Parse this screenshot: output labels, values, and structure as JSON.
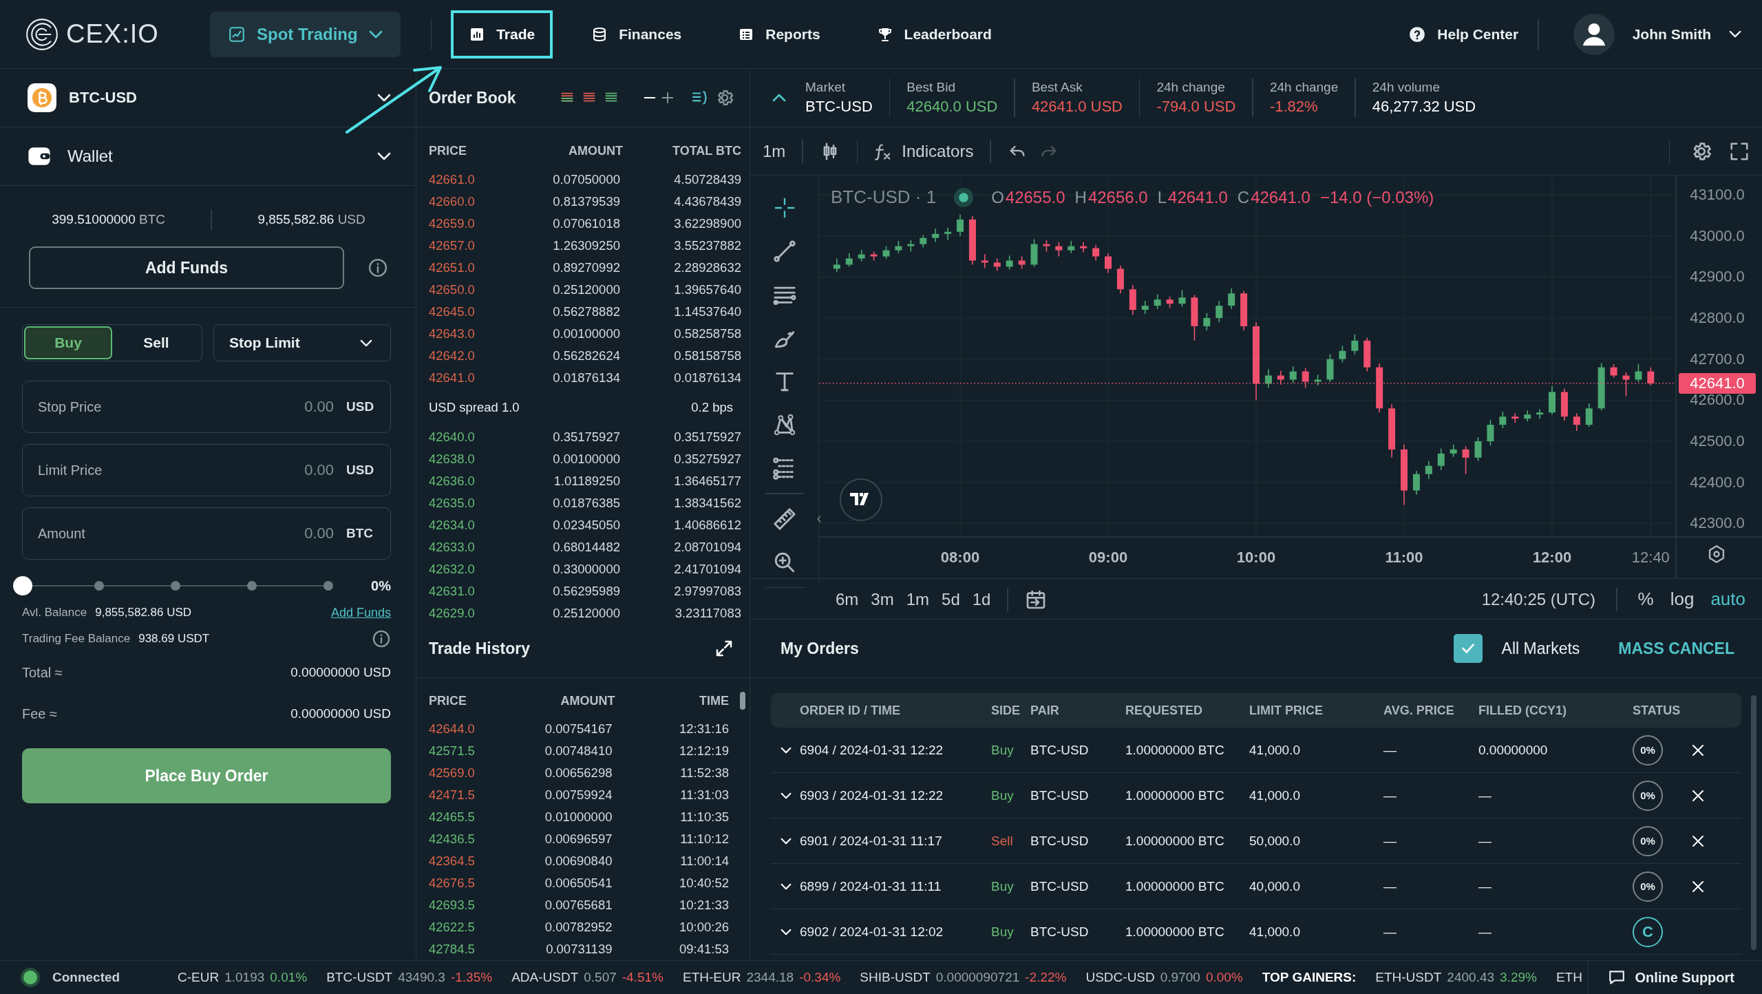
{
  "header": {
    "logo": "CEX:IO",
    "product": "Spot Trading",
    "nav": [
      {
        "label": "Trade",
        "selected": true
      },
      {
        "label": "Finances",
        "selected": false
      },
      {
        "label": "Reports",
        "selected": false
      },
      {
        "label": "Leaderboard",
        "selected": false
      }
    ],
    "help": "Help Center",
    "user": "John Smith"
  },
  "pair": {
    "name": "BTC-USD"
  },
  "wallet": {
    "title": "Wallet",
    "balances": [
      {
        "amount": "399.51000000",
        "currency": "BTC"
      },
      {
        "amount": "9,855,582.86",
        "currency": "USD"
      }
    ],
    "add_funds": "Add Funds"
  },
  "order_form": {
    "sides": [
      {
        "label": "Buy",
        "selected": true
      },
      {
        "label": "Sell",
        "selected": false
      }
    ],
    "order_type": "Stop Limit",
    "fields": [
      {
        "label": "Stop Price",
        "placeholder": "0.00",
        "unit": "USD"
      },
      {
        "label": "Limit Price",
        "placeholder": "0.00",
        "unit": "USD"
      },
      {
        "label": "Amount",
        "placeholder": "0.00",
        "unit": "BTC"
      }
    ],
    "slider": {
      "level": 0,
      "reading": "0%"
    },
    "avl_balance": {
      "label": "Avl. Balance",
      "value": "9,855,582.86 USD",
      "link": "Add Funds"
    },
    "fee_balance": {
      "label": "Trading Fee Balance",
      "value": "938.69 USDT"
    },
    "total": {
      "label": "Total ≈",
      "value": "0.00000000 USD"
    },
    "fee": {
      "label": "Fee ≈",
      "value": "0.00000000 USD"
    },
    "submit": "Place Buy Order"
  },
  "order_book": {
    "title": "Order Book",
    "columns": [
      "PRICE",
      "AMOUNT",
      "TOTAL BTC"
    ],
    "asks": [
      {
        "price": "42661.0",
        "amount": "0.07050000",
        "total": "4.50728439"
      },
      {
        "price": "42660.0",
        "amount": "0.81379539",
        "total": "4.43678439"
      },
      {
        "price": "42659.0",
        "amount": "0.07061018",
        "total": "3.62298900"
      },
      {
        "price": "42657.0",
        "amount": "1.26309250",
        "total": "3.55237882"
      },
      {
        "price": "42651.0",
        "amount": "0.89270992",
        "total": "2.28928632"
      },
      {
        "price": "42650.0",
        "amount": "0.25120000",
        "total": "1.39657640"
      },
      {
        "price": "42645.0",
        "amount": "0.56278882",
        "total": "1.14537640"
      },
      {
        "price": "42643.0",
        "amount": "0.00100000",
        "total": "0.58258758"
      },
      {
        "price": "42642.0",
        "amount": "0.56282624",
        "total": "0.58158758"
      },
      {
        "price": "42641.0",
        "amount": "0.01876134",
        "total": "0.01876134"
      }
    ],
    "spread": {
      "label": "USD spread",
      "value": "1.0",
      "bps": "0.2 bps"
    },
    "bids": [
      {
        "price": "42640.0",
        "amount": "0.35175927",
        "total": "0.35175927"
      },
      {
        "price": "42638.0",
        "amount": "0.00100000",
        "total": "0.35275927"
      },
      {
        "price": "42636.0",
        "amount": "1.01189250",
        "total": "1.36465177"
      },
      {
        "price": "42635.0",
        "amount": "0.01876385",
        "total": "1.38341562"
      },
      {
        "price": "42634.0",
        "amount": "0.02345050",
        "total": "1.40686612"
      },
      {
        "price": "42633.0",
        "amount": "0.68014482",
        "total": "2.08701094"
      },
      {
        "price": "42632.0",
        "amount": "0.33000000",
        "total": "2.41701094"
      },
      {
        "price": "42631.0",
        "amount": "0.56295989",
        "total": "2.97997083"
      },
      {
        "price": "42629.0",
        "amount": "0.25120000",
        "total": "3.23117083"
      }
    ]
  },
  "trade_history": {
    "title": "Trade History",
    "columns": [
      "PRICE",
      "AMOUNT",
      "TIME"
    ],
    "rows": [
      {
        "price": "42644.0",
        "amount": "0.00754167",
        "time": "12:31:16",
        "color": "#dc6449"
      },
      {
        "price": "42571.5",
        "amount": "0.00748410",
        "time": "12:12:19",
        "color": "#66bb74"
      },
      {
        "price": "42569.0",
        "amount": "0.00656298",
        "time": "11:52:38",
        "color": "#dc6449"
      },
      {
        "price": "42471.5",
        "amount": "0.00759924",
        "time": "11:31:03",
        "color": "#dc6449"
      },
      {
        "price": "42465.5",
        "amount": "0.01000000",
        "time": "11:10:35",
        "color": "#66bb74"
      },
      {
        "price": "42436.5",
        "amount": "0.00696597",
        "time": "11:10:12",
        "color": "#66bb74"
      },
      {
        "price": "42364.5",
        "amount": "0.00690840",
        "time": "11:00:14",
        "color": "#dc6449"
      },
      {
        "price": "42676.5",
        "amount": "0.00650541",
        "time": "10:40:52",
        "color": "#dc6449"
      },
      {
        "price": "42693.5",
        "amount": "0.00765681",
        "time": "10:21:33",
        "color": "#66bb74"
      },
      {
        "price": "42622.5",
        "amount": "0.00782952",
        "time": "10:00:26",
        "color": "#66bb74"
      },
      {
        "price": "42784.5",
        "amount": "0.00731139",
        "time": "09:41:53",
        "color": "#66bb74"
      }
    ]
  },
  "market_stats": [
    {
      "label": "Market",
      "value": "BTC-USD",
      "color": "#ffffff"
    },
    {
      "label": "Best Bid",
      "value": "42640.0 USD",
      "color": "#66bb74"
    },
    {
      "label": "Best Ask",
      "value": "42641.0 USD",
      "color": "#ee5a55"
    },
    {
      "label": "24h change",
      "value": "-794.0 USD",
      "color": "#ee5a55"
    },
    {
      "label": "24h change",
      "value": "-1.82%",
      "color": "#ee5a55"
    },
    {
      "label": "24h volume",
      "value": "46,277.32 USD",
      "color": "#ffffff"
    }
  ],
  "chart": {
    "interval": "1m",
    "indicators": "Indicators",
    "symbol": "BTC-USD · 1",
    "ohlc": [
      {
        "key": "O",
        "value": "42655.0"
      },
      {
        "key": "H",
        "value": "42656.0"
      },
      {
        "key": "L",
        "value": "42641.0"
      },
      {
        "key": "C",
        "value": "42641.0"
      }
    ],
    "change": "−14.0 (−0.03%)",
    "chart_data": {
      "type": "candlestick",
      "grid": true,
      "ref_lines": [
        {
          "axis": "y",
          "value": 42641,
          "label": "42641.0"
        }
      ],
      "categories": [
        null,
        null,
        null,
        null,
        null,
        null,
        null,
        null,
        null,
        null,
        "08:00",
        null,
        null,
        null,
        null,
        null,
        null,
        null,
        null,
        null,
        null,
        null,
        "09:00",
        null,
        null,
        null,
        null,
        null,
        null,
        null,
        null,
        null,
        null,
        null,
        "10:00",
        null,
        null,
        null,
        null,
        null,
        null,
        null,
        null,
        null,
        null,
        null,
        "11:00",
        null,
        null,
        null,
        null,
        null,
        null,
        null,
        null,
        null,
        null,
        null,
        "12:00",
        null,
        null,
        null,
        null,
        null,
        null,
        null,
        "12:40"
      ],
      "ylim": [
        42267,
        43147
      ],
      "ohlc": [
        [
          42920,
          42945,
          42912,
          42930
        ],
        [
          42930,
          42958,
          42925,
          42945
        ],
        [
          42945,
          42966,
          42938,
          42955
        ],
        [
          42955,
          42962,
          42940,
          42950
        ],
        [
          42950,
          42975,
          42944,
          42965
        ],
        [
          42965,
          42988,
          42958,
          42975
        ],
        [
          42975,
          42990,
          42962,
          42980
        ],
        [
          42980,
          43002,
          42972,
          42995
        ],
        [
          42995,
          43018,
          42985,
          43005
        ],
        [
          43005,
          43020,
          42990,
          43010
        ],
        [
          43010,
          43052,
          43000,
          43040
        ],
        [
          43040,
          43048,
          42930,
          42940
        ],
        [
          42940,
          42955,
          42922,
          42935
        ],
        [
          42935,
          42945,
          42915,
          42925
        ],
        [
          42925,
          42952,
          42918,
          42940
        ],
        [
          42940,
          42950,
          42920,
          42930
        ],
        [
          42930,
          42992,
          42925,
          42980
        ],
        [
          42980,
          42990,
          42962,
          42975
        ],
        [
          42975,
          42985,
          42950,
          42965
        ],
        [
          42965,
          42988,
          42958,
          42975
        ],
        [
          42975,
          42985,
          42960,
          42970
        ],
        [
          42970,
          42978,
          42940,
          42950
        ],
        [
          42950,
          42958,
          42910,
          42920
        ],
        [
          42920,
          42928,
          42860,
          42870
        ],
        [
          42870,
          42880,
          42808,
          42820
        ],
        [
          42820,
          42842,
          42810,
          42830
        ],
        [
          42830,
          42858,
          42822,
          42845
        ],
        [
          42845,
          42852,
          42825,
          42835
        ],
        [
          42835,
          42868,
          42828,
          42850
        ],
        [
          42850,
          42856,
          42745,
          42780
        ],
        [
          42780,
          42812,
          42770,
          42800
        ],
        [
          42800,
          42842,
          42790,
          42830
        ],
        [
          42830,
          42872,
          42822,
          42860
        ],
        [
          42860,
          42866,
          42770,
          42780
        ],
        [
          42780,
          42790,
          42600,
          42640
        ],
        [
          42640,
          42675,
          42630,
          42660
        ],
        [
          42660,
          42672,
          42638,
          42650
        ],
        [
          42650,
          42682,
          42642,
          42670
        ],
        [
          42670,
          42678,
          42630,
          42645
        ],
        [
          42645,
          42662,
          42636,
          42650
        ],
        [
          42650,
          42712,
          42644,
          42700
        ],
        [
          42700,
          42732,
          42692,
          42720
        ],
        [
          42720,
          42760,
          42712,
          42745
        ],
        [
          42745,
          42752,
          42670,
          42680
        ],
        [
          42680,
          42690,
          42570,
          42580
        ],
        [
          42580,
          42590,
          42460,
          42480
        ],
        [
          42480,
          42492,
          42345,
          42380
        ],
        [
          42380,
          42428,
          42370,
          42420
        ],
        [
          42420,
          42452,
          42408,
          42440
        ],
        [
          42440,
          42482,
          42430,
          42470
        ],
        [
          42470,
          42492,
          42462,
          42480
        ],
        [
          42480,
          42488,
          42420,
          42460
        ],
        [
          42460,
          42510,
          42452,
          42500
        ],
        [
          42500,
          42552,
          42490,
          42540
        ],
        [
          42540,
          42572,
          42532,
          42560
        ],
        [
          42560,
          42568,
          42545,
          42555
        ],
        [
          42555,
          42575,
          42548,
          42565
        ],
        [
          42565,
          42578,
          42555,
          42570
        ],
        [
          42570,
          42635,
          42565,
          42620
        ],
        [
          42620,
          42628,
          42550,
          42560
        ],
        [
          42560,
          42568,
          42525,
          42540
        ],
        [
          42540,
          42592,
          42535,
          42580
        ],
        [
          42580,
          42690,
          42575,
          42680
        ],
        [
          42680,
          42688,
          42655,
          42660
        ],
        [
          42660,
          42668,
          42610,
          42650
        ],
        [
          42650,
          42688,
          42644,
          42670
        ],
        [
          42670,
          42680,
          42636,
          42641
        ]
      ],
      "yticks": [
        {
          "value": 43100,
          "label": "43100.0"
        },
        {
          "value": 43000,
          "label": "43000.0"
        },
        {
          "value": 42900,
          "label": "42900.0"
        },
        {
          "value": 42800,
          "label": "42800.0"
        },
        {
          "value": 42700,
          "label": "42700.0"
        },
        {
          "value": 42600,
          "label": "42600.0"
        },
        {
          "value": 42500,
          "label": "42500.0"
        },
        {
          "value": 42400,
          "label": "42400.0"
        },
        {
          "value": 42300,
          "label": "42300.0"
        }
      ]
    },
    "ranges": [
      "6m",
      "3m",
      "1m",
      "5d",
      "1d"
    ],
    "clock": "12:40:25 (UTC)",
    "scale_options": [
      {
        "label": "%",
        "selected": false
      },
      {
        "label": "log",
        "selected": false
      },
      {
        "label": "auto",
        "selected": true
      }
    ]
  },
  "my_orders": {
    "title": "My Orders",
    "all_markets": {
      "label": "All Markets",
      "checked": true
    },
    "mass_cancel": "MASS CANCEL",
    "columns": [
      "ORDER ID / TIME",
      "SIDE",
      "PAIR",
      "REQUESTED",
      "LIMIT PRICE",
      "AVG. PRICE",
      "FILLED (CCY1)",
      "STATUS"
    ],
    "rows": [
      {
        "id_time": "6904 / 2024-01-31 12:22",
        "side": "Buy",
        "color": "#66bb74",
        "pair": "BTC-USD",
        "requested": "1.00000000 BTC",
        "limit": "41,000.0",
        "avg": "—",
        "filled": "0.00000000",
        "status": "0%",
        "canceled": false,
        "cancellable": true
      },
      {
        "id_time": "6903 / 2024-01-31 12:22",
        "side": "Buy",
        "color": "#66bb74",
        "pair": "BTC-USD",
        "requested": "1.00000000 BTC",
        "limit": "41,000.0",
        "avg": "—",
        "filled": "—",
        "status": "0%",
        "canceled": false,
        "cancellable": true
      },
      {
        "id_time": "6901 / 2024-01-31 11:17",
        "side": "Sell",
        "color": "#dc6449",
        "pair": "BTC-USD",
        "requested": "1.00000000 BTC",
        "limit": "50,000.0",
        "avg": "—",
        "filled": "—",
        "status": "0%",
        "canceled": false,
        "cancellable": true
      },
      {
        "id_time": "6899 / 2024-01-31 11:11",
        "side": "Buy",
        "color": "#66bb74",
        "pair": "BTC-USD",
        "requested": "1.00000000 BTC",
        "limit": "40,000.0",
        "avg": "—",
        "filled": "—",
        "status": "0%",
        "canceled": false,
        "cancellable": true
      },
      {
        "id_time": "6902 / 2024-01-31 12:02",
        "side": "Buy",
        "color": "#66bb74",
        "pair": "BTC-USD",
        "requested": "1.00000000 BTC",
        "limit": "41,000.0",
        "avg": "—",
        "filled": "—",
        "status": "C",
        "canceled": true,
        "cancellable": false
      }
    ]
  },
  "status_bar": {
    "connection": {
      "label": "Connected",
      "on": true
    },
    "ticker": [
      {
        "pair": "C-EUR",
        "price": "1.0193",
        "change": "0.01%",
        "color": "#66bb74"
      },
      {
        "pair": "BTC-USDT",
        "price": "43490.3",
        "change": "-1.35%",
        "color": "#ee5a55"
      },
      {
        "pair": "ADA-USDT",
        "price": "0.507",
        "change": "-4.51%",
        "color": "#ee5a55"
      },
      {
        "pair": "ETH-EUR",
        "price": "2344.18",
        "change": "-0.34%",
        "color": "#ee5a55"
      },
      {
        "pair": "SHIB-USDT",
        "price": "0.0000090721",
        "change": "-2.22%",
        "color": "#ee5a55"
      },
      {
        "pair": "USDC-USD",
        "price": "0.9700",
        "change": "0.00%",
        "color": "#ee5a55"
      }
    ],
    "gainers_label": "TOP GAINERS:",
    "gainers": [
      {
        "pair": "ETH-USDT",
        "price": "2400.43",
        "change": "3.29%",
        "color": "#66bb74"
      },
      {
        "pair": "ETH"
      }
    ],
    "support": "Online Support"
  }
}
